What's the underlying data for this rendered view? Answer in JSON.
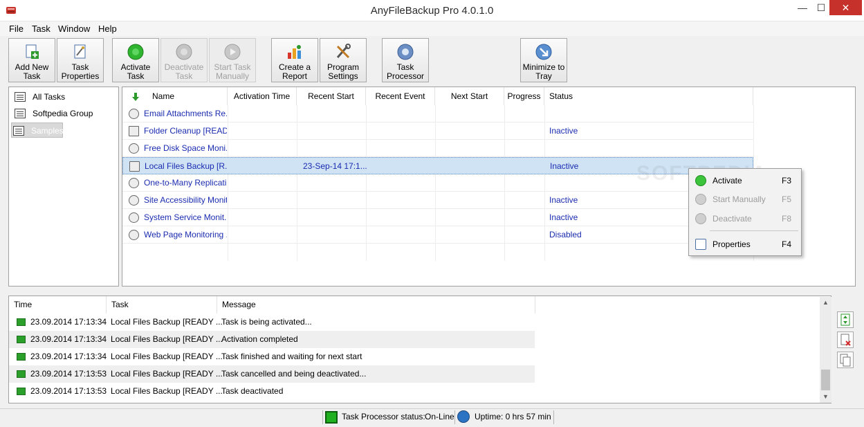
{
  "window": {
    "title": "AnyFileBackup Pro 4.0.1.0"
  },
  "menu": [
    "File",
    "Task",
    "Window",
    "Help"
  ],
  "toolbar": {
    "add_new_task": [
      "Add New",
      "Task"
    ],
    "task_properties": [
      "Task",
      "Properties"
    ],
    "activate_task": [
      "Activate",
      "Task"
    ],
    "deactivate_task": [
      "Deactivate",
      "Task"
    ],
    "start_task_manually": [
      "Start Task",
      "Manually"
    ],
    "create_report": [
      "Create a",
      "Report"
    ],
    "program_settings": [
      "Program",
      "Settings"
    ],
    "task_processor": [
      "Task",
      "Processor"
    ],
    "minimize_to_tray": [
      "Minimize to",
      "Tray"
    ]
  },
  "tree": [
    "All Tasks",
    "Softpedia Group",
    "Samples"
  ],
  "tasklist": {
    "columns": [
      "Name",
      "Activation Time",
      "Recent Start",
      "Recent Event",
      "Next Start",
      "Progress",
      "Status"
    ],
    "rows": [
      {
        "name": "Email Attachments Re...",
        "recent_start": "",
        "status": "",
        "icon": "email-task-icon"
      },
      {
        "name": "Folder Cleanup [READ...",
        "recent_start": "",
        "status": "Inactive",
        "icon": "folder-task-icon"
      },
      {
        "name": "Free Disk Space Moni...",
        "recent_start": "",
        "status": "",
        "icon": "disk-task-icon"
      },
      {
        "name": "Local Files Backup [R...",
        "recent_start": "23-Sep-14 17:1...",
        "status": "Inactive",
        "icon": "backup-task-icon"
      },
      {
        "name": "One-to-Many Replicati...",
        "recent_start": "",
        "status": "",
        "icon": "replication-task-icon"
      },
      {
        "name": "Site Accessibility Monit...",
        "recent_start": "",
        "status": "Inactive",
        "icon": "site-task-icon"
      },
      {
        "name": "System Service Monit...",
        "recent_start": "",
        "status": "Inactive",
        "icon": "service-task-icon"
      },
      {
        "name": "Web Page Monitoring ...",
        "recent_start": "",
        "status": "Disabled",
        "icon": "webpage-task-icon"
      }
    ]
  },
  "context_menu": [
    {
      "label": "Activate",
      "key": "F3",
      "disabled": false
    },
    {
      "label": "Start Manually",
      "key": "F5",
      "disabled": true
    },
    {
      "label": "Deactivate",
      "key": "F8",
      "disabled": true
    },
    {
      "label": "Properties",
      "key": "F4",
      "disabled": false
    }
  ],
  "log": {
    "columns": [
      "Time",
      "Task",
      "Message"
    ],
    "rows": [
      {
        "time": "23.09.2014  17:13:34",
        "task": "Local Files Backup [READY ...",
        "message": "Task is being activated..."
      },
      {
        "time": "23.09.2014  17:13:34",
        "task": "Local Files Backup [READY ...",
        "message": "Activation completed"
      },
      {
        "time": "23.09.2014  17:13:34",
        "task": "Local Files Backup [READY ...",
        "message": "Task finished and waiting for next start"
      },
      {
        "time": "23.09.2014  17:13:53",
        "task": "Local Files Backup [READY ...",
        "message": "Task cancelled and being deactivated..."
      },
      {
        "time": "23.09.2014  17:13:53",
        "task": "Local Files Backup [READY ...",
        "message": "Task deactivated"
      }
    ]
  },
  "statusbar": {
    "processor_label": "Task Processor status:",
    "processor_value": "On-Line",
    "uptime": "Uptime: 0 hrs 57 min"
  },
  "watermark": "SOFTPEDIA",
  "colors": {
    "link_blue": "#1a2bb0",
    "close_red": "#c7312b",
    "status_green": "#20b020"
  }
}
